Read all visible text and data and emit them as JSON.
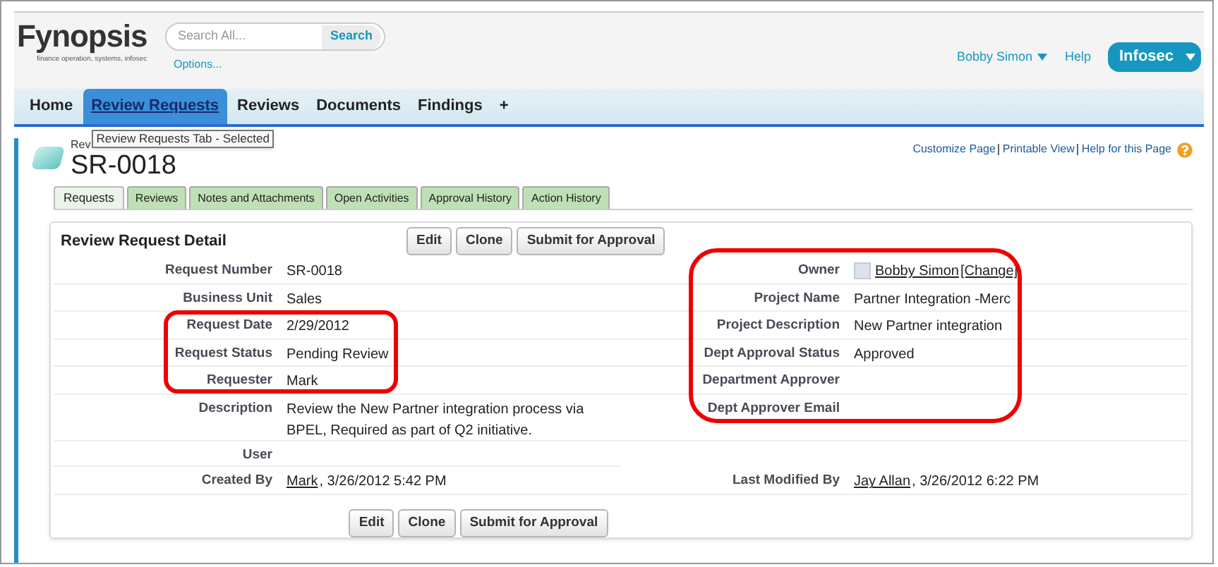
{
  "header": {
    "logo": "Fynopsis",
    "tagline": "finance operation, systems, infosec",
    "search": {
      "placeholder": "Search All...",
      "button": "Search",
      "options_link": "Options..."
    },
    "user_menu": "Bobby Simon",
    "help": "Help",
    "app_menu": "Infosec"
  },
  "nav_tabs": [
    {
      "label": "Home",
      "selected": false
    },
    {
      "label": "Review Requests",
      "selected": true
    },
    {
      "label": "Reviews",
      "selected": false
    },
    {
      "label": "Documents",
      "selected": false
    },
    {
      "label": "Findings",
      "selected": false
    },
    {
      "label": "+",
      "selected": false
    }
  ],
  "tooltip": "Review Requests Tab - Selected",
  "record": {
    "type_label": "Rev",
    "name": "SR-0018"
  },
  "page_links": [
    "Customize Page",
    "Printable View",
    "Help for this Page"
  ],
  "sub_tabs": [
    {
      "label": "Requests",
      "selected": true
    },
    {
      "label": "Reviews",
      "selected": false
    },
    {
      "label": "Notes and Attachments",
      "selected": false
    },
    {
      "label": "Open Activities",
      "selected": false
    },
    {
      "label": "Approval History",
      "selected": false
    },
    {
      "label": "Action History",
      "selected": false
    }
  ],
  "detail": {
    "title": "Review Request Detail",
    "top_buttons": [
      "Edit",
      "Clone",
      "Submit for Approval"
    ],
    "bottom_buttons": [
      "Edit",
      "Clone",
      "Submit for Approval"
    ],
    "rows": [
      {
        "left": {
          "label": "Request Number",
          "value": [
            {
              "text": "SR-0018",
              "link": false
            }
          ]
        },
        "right": {
          "label": "Owner",
          "avatar": true,
          "value": [
            {
              "text": "Bobby Simon",
              "link": true
            },
            {
              "text": "[Change]",
              "link": true
            }
          ]
        }
      },
      {
        "left": {
          "label": "Business Unit",
          "value": [
            {
              "text": "Sales",
              "link": false
            }
          ]
        },
        "right": {
          "label": "Project Name",
          "value": [
            {
              "text": "Partner Integration -Merc",
              "link": false
            }
          ]
        }
      },
      {
        "left": {
          "label": "Request Date",
          "value": [
            {
              "text": "2/29/2012",
              "link": false
            }
          ]
        },
        "right": {
          "label": "Project Description",
          "value": [
            {
              "text": "New Partner integration",
              "link": false
            }
          ]
        }
      },
      {
        "left": {
          "label": "Request Status",
          "value": [
            {
              "text": "Pending Review",
              "link": false
            }
          ]
        },
        "right": {
          "label": "Dept Approval Status",
          "value": [
            {
              "text": "Approved",
              "link": false
            }
          ]
        }
      },
      {
        "left": {
          "label": "Requester",
          "value": [
            {
              "text": "Mark",
              "link": false
            }
          ]
        },
        "right": {
          "label": "Department Approver"
        }
      },
      {
        "left": {
          "label": "Description",
          "value": [
            {
              "text": "Review the New Partner integration process via BPEL, Required as part of Q2 initiative.",
              "link": false
            }
          ]
        },
        "right": {
          "label": "Dept Approver Email"
        }
      },
      {
        "left": {
          "label": "User"
        }
      },
      {
        "left": {
          "label": "Created By",
          "value": [
            {
              "text": "Mark",
              "link": true
            },
            {
              "text": ", 3/26/2012 5:42 PM",
              "link": false
            }
          ]
        },
        "right": {
          "label": "Last Modified By",
          "value": [
            {
              "text": "Jay Allan",
              "link": true
            },
            {
              "text": ", 3/26/2012 6:22 PM",
              "link": false
            }
          ]
        }
      }
    ]
  }
}
